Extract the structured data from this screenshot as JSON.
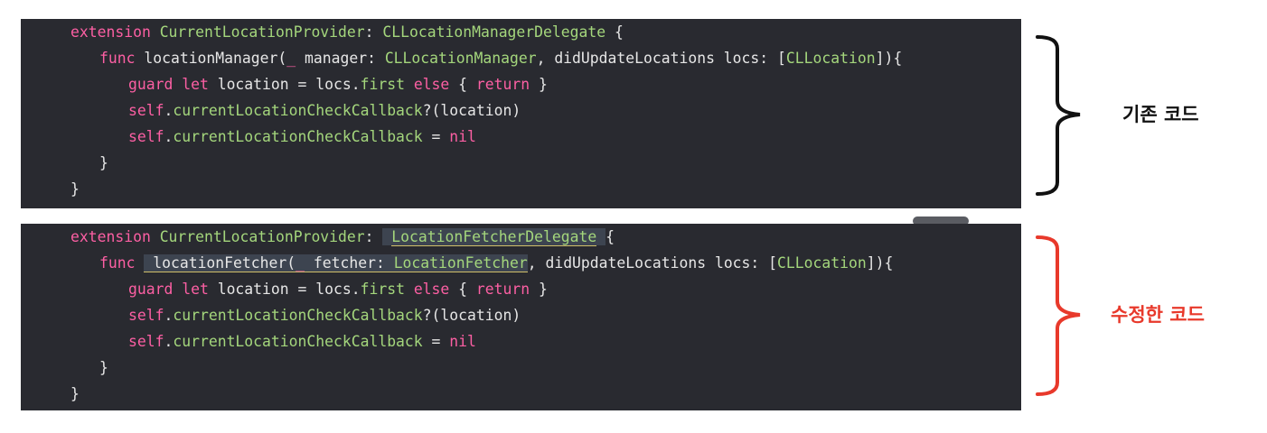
{
  "colors": {
    "editor_background": "#292a30",
    "keyword": "#fc5fa3",
    "type": "#a4d67c",
    "plain_text": "#e6e6e6",
    "highlight_background": "#3d4450",
    "highlight_underline": "#d0bf69",
    "original_brace": "#111111",
    "modified_brace": "#e8392b"
  },
  "original_code": {
    "caption": "기존 코드",
    "lines": [
      {
        "indent": 0,
        "tokens": [
          {
            "t": "extension",
            "k": "kw"
          },
          {
            "t": " ",
            "k": "pl"
          },
          {
            "t": "CurrentLocationProvider",
            "k": "type"
          },
          {
            "t": ": ",
            "k": "pl"
          },
          {
            "t": "CLLocationManagerDelegate",
            "k": "type"
          },
          {
            "t": " {",
            "k": "pl"
          }
        ]
      },
      {
        "indent": 1,
        "tokens": [
          {
            "t": "func",
            "k": "kw"
          },
          {
            "t": " locationManager(",
            "k": "pl"
          },
          {
            "t": "_",
            "k": "kw"
          },
          {
            "t": " manager: ",
            "k": "pl"
          },
          {
            "t": "CLLocationManager",
            "k": "type"
          },
          {
            "t": ", didUpdateLocations locs: [",
            "k": "pl"
          },
          {
            "t": "CLLocation",
            "k": "type"
          },
          {
            "t": "]){",
            "k": "pl"
          }
        ]
      },
      {
        "indent": 2,
        "tokens": [
          {
            "t": "guard",
            "k": "kw"
          },
          {
            "t": " ",
            "k": "pl"
          },
          {
            "t": "let",
            "k": "kw"
          },
          {
            "t": " location = locs.",
            "k": "pl"
          },
          {
            "t": "first",
            "k": "type"
          },
          {
            "t": " ",
            "k": "pl"
          },
          {
            "t": "else",
            "k": "kw"
          },
          {
            "t": " { ",
            "k": "pl"
          },
          {
            "t": "return",
            "k": "kw"
          },
          {
            "t": " }",
            "k": "pl"
          }
        ]
      },
      {
        "indent": 2,
        "tokens": [
          {
            "t": "self",
            "k": "kw"
          },
          {
            "t": ".",
            "k": "pl"
          },
          {
            "t": "currentLocationCheckCallback",
            "k": "type"
          },
          {
            "t": "?(location)",
            "k": "pl"
          }
        ]
      },
      {
        "indent": 2,
        "tokens": [
          {
            "t": "self",
            "k": "kw"
          },
          {
            "t": ".",
            "k": "pl"
          },
          {
            "t": "currentLocationCheckCallback",
            "k": "type"
          },
          {
            "t": " = ",
            "k": "pl"
          },
          {
            "t": "nil",
            "k": "kw"
          }
        ]
      },
      {
        "indent": 1,
        "tokens": [
          {
            "t": "}",
            "k": "pl"
          }
        ]
      },
      {
        "indent": 0,
        "tokens": [
          {
            "t": "}",
            "k": "pl"
          }
        ]
      }
    ]
  },
  "modified_code": {
    "caption": "수정한 코드",
    "lines": [
      {
        "indent": 0,
        "tokens": [
          {
            "t": "extension",
            "k": "kw"
          },
          {
            "t": " ",
            "k": "pl"
          },
          {
            "t": "CurrentLocationProvider",
            "k": "type"
          },
          {
            "t": ": ",
            "k": "pl"
          },
          {
            "t": " ",
            "k": "pl",
            "hl": true
          },
          {
            "t": "LocationFetcherDelegate",
            "k": "type",
            "hl": true,
            "ul": true
          },
          {
            "t": " ",
            "k": "pl",
            "hl": true
          },
          {
            "t": "{",
            "k": "pl"
          }
        ]
      },
      {
        "indent": 1,
        "tokens": [
          {
            "t": "func",
            "k": "kw"
          },
          {
            "t": " ",
            "k": "pl"
          },
          {
            "t": " locationFetcher(",
            "k": "pl",
            "hl": true,
            "ul": true
          },
          {
            "t": "_",
            "k": "kw",
            "hl": true,
            "ul": true
          },
          {
            "t": " fetcher: ",
            "k": "pl",
            "hl": true,
            "ul": true
          },
          {
            "t": "LocationFetcher",
            "k": "type",
            "hl": true,
            "ul": true
          },
          {
            "t": ", didUpdateLocations locs: [",
            "k": "pl"
          },
          {
            "t": "CLLocation",
            "k": "type"
          },
          {
            "t": "]){",
            "k": "pl"
          }
        ]
      },
      {
        "indent": 2,
        "tokens": [
          {
            "t": "guard",
            "k": "kw"
          },
          {
            "t": " ",
            "k": "pl"
          },
          {
            "t": "let",
            "k": "kw"
          },
          {
            "t": " location = locs.",
            "k": "pl"
          },
          {
            "t": "first",
            "k": "type"
          },
          {
            "t": " ",
            "k": "pl"
          },
          {
            "t": "else",
            "k": "kw"
          },
          {
            "t": " { ",
            "k": "pl"
          },
          {
            "t": "return",
            "k": "kw"
          },
          {
            "t": " }",
            "k": "pl"
          }
        ]
      },
      {
        "indent": 2,
        "tokens": [
          {
            "t": "self",
            "k": "kw"
          },
          {
            "t": ".",
            "k": "pl"
          },
          {
            "t": "currentLocationCheckCallback",
            "k": "type"
          },
          {
            "t": "?(location)",
            "k": "pl"
          }
        ]
      },
      {
        "indent": 2,
        "tokens": [
          {
            "t": "self",
            "k": "kw"
          },
          {
            "t": ".",
            "k": "pl"
          },
          {
            "t": "currentLocationCheckCallback",
            "k": "type"
          },
          {
            "t": " = ",
            "k": "pl"
          },
          {
            "t": "nil",
            "k": "kw"
          }
        ]
      },
      {
        "indent": 1,
        "tokens": [
          {
            "t": "}",
            "k": "pl"
          }
        ]
      },
      {
        "indent": 0,
        "tokens": [
          {
            "t": "}",
            "k": "pl"
          }
        ]
      }
    ]
  }
}
